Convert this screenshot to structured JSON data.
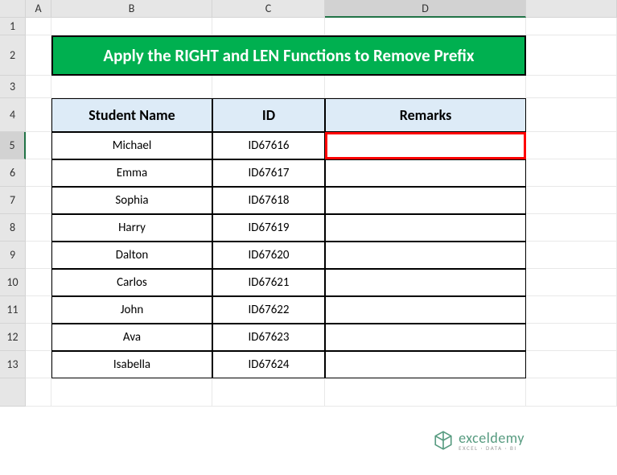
{
  "columns": [
    "A",
    "B",
    "C",
    "D",
    ""
  ],
  "rows": [
    "1",
    "2",
    "3",
    "4",
    "5",
    "6",
    "7",
    "8",
    "9",
    "10",
    "11",
    "12",
    "13"
  ],
  "title": "Apply the RIGHT and LEN Functions to Remove Prefix",
  "headers": {
    "name": "Student Name",
    "id": "ID",
    "remarks": "Remarks"
  },
  "data": [
    {
      "name": "Michael",
      "id": "ID67616",
      "remarks": ""
    },
    {
      "name": "Emma",
      "id": "ID67617",
      "remarks": ""
    },
    {
      "name": "Sophia",
      "id": "ID67618",
      "remarks": ""
    },
    {
      "name": "Harry",
      "id": "ID67619",
      "remarks": ""
    },
    {
      "name": "Dalton",
      "id": "ID67620",
      "remarks": ""
    },
    {
      "name": "Carlos",
      "id": "ID67621",
      "remarks": ""
    },
    {
      "name": "John",
      "id": "ID67622",
      "remarks": ""
    },
    {
      "name": "Ava",
      "id": "ID67623",
      "remarks": ""
    },
    {
      "name": "Isabella",
      "id": "ID67624",
      "remarks": ""
    }
  ],
  "selected_cell": {
    "row": 5,
    "col": "D"
  },
  "watermark": {
    "main": "exceldemy",
    "sub": "EXCEL · DATA · BI"
  },
  "chart_data": {
    "type": "table",
    "title": "Apply the RIGHT and LEN Functions to Remove Prefix",
    "columns": [
      "Student Name",
      "ID",
      "Remarks"
    ],
    "rows": [
      [
        "Michael",
        "ID67616",
        ""
      ],
      [
        "Emma",
        "ID67617",
        ""
      ],
      [
        "Sophia",
        "ID67618",
        ""
      ],
      [
        "Harry",
        "ID67619",
        ""
      ],
      [
        "Dalton",
        "ID67620",
        ""
      ],
      [
        "Carlos",
        "ID67621",
        ""
      ],
      [
        "John",
        "ID67622",
        ""
      ],
      [
        "Ava",
        "ID67623",
        ""
      ],
      [
        "Isabella",
        "ID67624",
        ""
      ]
    ]
  }
}
